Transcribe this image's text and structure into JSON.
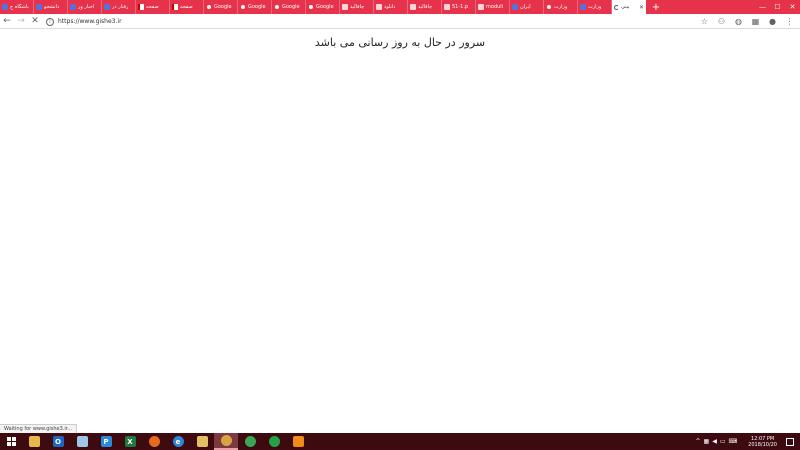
{
  "browser": {
    "tabs": [
      {
        "title": "باشگاه ج",
        "favicon": "site-icon"
      },
      {
        "title": "دانشجو",
        "favicon": "site-icon"
      },
      {
        "title": "اخبار ور",
        "favicon": "site-icon"
      },
      {
        "title": "رفتار در",
        "favicon": "site-icon"
      },
      {
        "title": "صفحه",
        "favicon": "flag-icon"
      },
      {
        "title": "صفحه",
        "favicon": "flag-icon"
      },
      {
        "title": "Google",
        "favicon": "google-icon"
      },
      {
        "title": "Google",
        "favicon": "google-icon"
      },
      {
        "title": "Google",
        "favicon": "google-icon"
      },
      {
        "title": "Google",
        "favicon": "google-icon"
      },
      {
        "title": "چاقالید",
        "favicon": "doc-icon"
      },
      {
        "title": "دانلود",
        "favicon": "doc-icon"
      },
      {
        "title": "چاقالید",
        "favicon": "doc-icon"
      },
      {
        "title": "51-1.p",
        "favicon": "doc-icon"
      },
      {
        "title": "moduli",
        "favicon": "doc-icon"
      },
      {
        "title": "ایران",
        "favicon": "site-icon"
      },
      {
        "title": "وزارت",
        "favicon": "google-icon"
      },
      {
        "title": "وزارت",
        "favicon": "site-icon"
      }
    ],
    "active_tab": {
      "title": "بیتی"
    },
    "address": "https://www.gishe3.ir",
    "status_text": "Waiting for www.gishe3.ir..."
  },
  "page": {
    "heading": "سرور در حال به روز رسانی می باشد"
  },
  "taskbar": {
    "time": "12:07 PM",
    "date": "2018/10/20"
  }
}
